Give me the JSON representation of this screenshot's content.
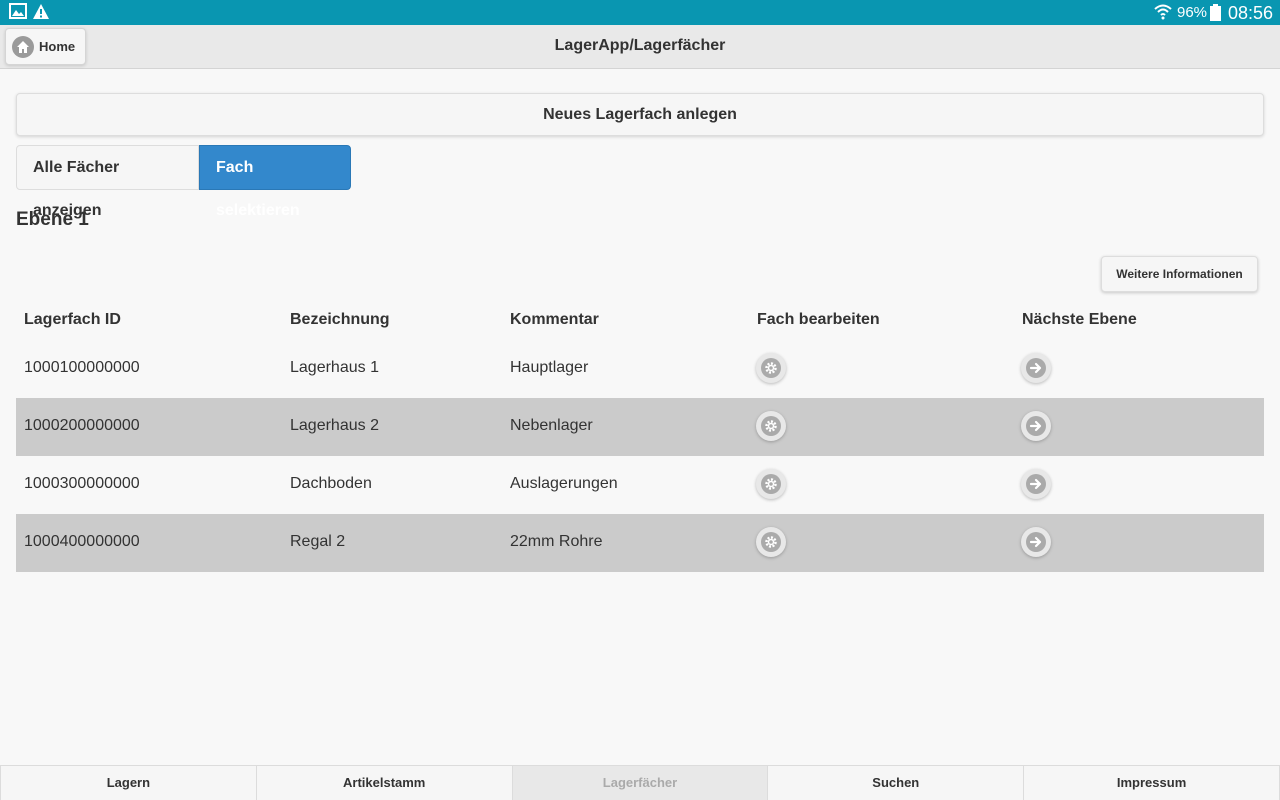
{
  "statusbar": {
    "battery_percent": "96%",
    "time": "08:56",
    "icons": [
      "image-icon",
      "warning-icon",
      "wifi-icon",
      "battery-icon"
    ]
  },
  "header": {
    "home_label": "Home",
    "title": "LagerApp/Lagerfächer"
  },
  "actions": {
    "new_label": "Neues Lagerfach anlegen",
    "show_all_label": "Alle Fächer anzeigen",
    "select_label": "Fach selektieren",
    "more_info_label": "Weitere Informationen"
  },
  "level_title": "Ebene 1",
  "table": {
    "headers": [
      "Lagerfach ID",
      "Bezeichnung",
      "Kommentar",
      "Fach bearbeiten",
      "Nächste Ebene"
    ],
    "rows": [
      {
        "id": "1000100000000",
        "name": "Lagerhaus 1",
        "comment": "Hauptlager"
      },
      {
        "id": "1000200000000",
        "name": "Lagerhaus 2",
        "comment": "Nebenlager"
      },
      {
        "id": "1000300000000",
        "name": "Dachboden",
        "comment": "Auslagerungen"
      },
      {
        "id": "1000400000000",
        "name": "Regal 2",
        "comment": "22mm Rohre"
      }
    ]
  },
  "navbar": {
    "items": [
      "Lagern",
      "Artikelstamm",
      "Lagerfächer",
      "Suchen",
      "Impressum"
    ],
    "active_index": 2
  },
  "colors": {
    "statusbar": "#0996b1",
    "selected_button": "#3388cc",
    "alt_row": "#cbcbcb"
  }
}
